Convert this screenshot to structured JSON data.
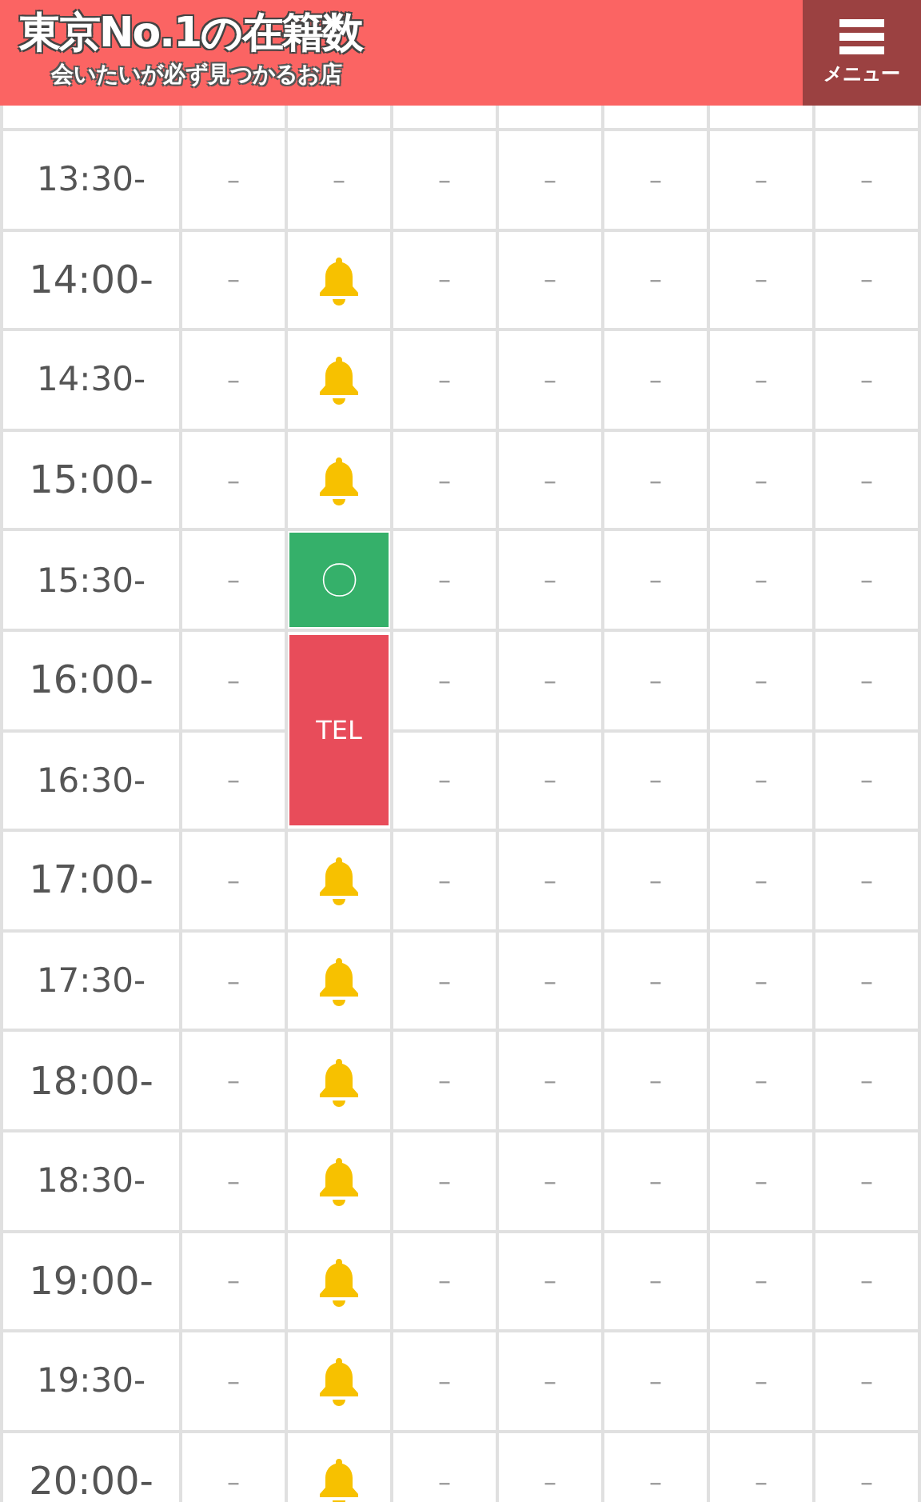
{
  "header": {
    "title": "東京No.1の在籍数",
    "subtitle": "会いたいが必ず見つかるお店",
    "menu_label": "メニュー"
  },
  "rows": [
    {
      "time": "13:30-",
      "kind": "half",
      "cells": [
        {
          "kind": "dash",
          "text": "–"
        },
        {
          "kind": "dash",
          "text": "–"
        },
        {
          "kind": "dash",
          "text": "–"
        },
        {
          "kind": "dash",
          "text": "–"
        },
        {
          "kind": "dash",
          "text": "–"
        },
        {
          "kind": "dash",
          "text": "–"
        },
        {
          "kind": "dash",
          "text": "–"
        }
      ]
    },
    {
      "time": "14:00-",
      "kind": "hour",
      "cells": [
        {
          "kind": "dash",
          "text": "–"
        },
        {
          "kind": "bell"
        },
        {
          "kind": "dash",
          "text": "–"
        },
        {
          "kind": "dash",
          "text": "–"
        },
        {
          "kind": "dash",
          "text": "–"
        },
        {
          "kind": "dash",
          "text": "–"
        },
        {
          "kind": "dash",
          "text": "–"
        }
      ]
    },
    {
      "time": "14:30-",
      "kind": "half",
      "cells": [
        {
          "kind": "dash",
          "text": "–"
        },
        {
          "kind": "bell"
        },
        {
          "kind": "dash",
          "text": "–"
        },
        {
          "kind": "dash",
          "text": "–"
        },
        {
          "kind": "dash",
          "text": "–"
        },
        {
          "kind": "dash",
          "text": "–"
        },
        {
          "kind": "dash",
          "text": "–"
        }
      ]
    },
    {
      "time": "15:00-",
      "kind": "hour",
      "cells": [
        {
          "kind": "dash",
          "text": "–"
        },
        {
          "kind": "bell"
        },
        {
          "kind": "dash",
          "text": "–"
        },
        {
          "kind": "dash",
          "text": "–"
        },
        {
          "kind": "dash",
          "text": "–"
        },
        {
          "kind": "dash",
          "text": "–"
        },
        {
          "kind": "dash",
          "text": "–"
        }
      ]
    },
    {
      "time": "15:30-",
      "kind": "half",
      "cells": [
        {
          "kind": "dash",
          "text": "–"
        },
        {
          "kind": "ok",
          "text": "〇"
        },
        {
          "kind": "dash",
          "text": "–"
        },
        {
          "kind": "dash",
          "text": "–"
        },
        {
          "kind": "dash",
          "text": "–"
        },
        {
          "kind": "dash",
          "text": "–"
        },
        {
          "kind": "dash",
          "text": "–"
        }
      ]
    },
    {
      "time": "16:00-",
      "kind": "hour",
      "cells": [
        {
          "kind": "dash",
          "text": "–"
        },
        {
          "kind": "tel",
          "text": "TEL"
        },
        {
          "kind": "dash",
          "text": "–"
        },
        {
          "kind": "dash",
          "text": "–"
        },
        {
          "kind": "dash",
          "text": "–"
        },
        {
          "kind": "dash",
          "text": "–"
        },
        {
          "kind": "dash",
          "text": "–"
        }
      ]
    },
    {
      "time": "16:30-",
      "kind": "half",
      "cells": [
        {
          "kind": "dash",
          "text": "–"
        },
        {
          "kind": "merged"
        },
        {
          "kind": "dash",
          "text": "–"
        },
        {
          "kind": "dash",
          "text": "–"
        },
        {
          "kind": "dash",
          "text": "–"
        },
        {
          "kind": "dash",
          "text": "–"
        },
        {
          "kind": "dash",
          "text": "–"
        }
      ]
    },
    {
      "time": "17:00-",
      "kind": "hour",
      "cells": [
        {
          "kind": "dash",
          "text": "–"
        },
        {
          "kind": "bell"
        },
        {
          "kind": "dash",
          "text": "–"
        },
        {
          "kind": "dash",
          "text": "–"
        },
        {
          "kind": "dash",
          "text": "–"
        },
        {
          "kind": "dash",
          "text": "–"
        },
        {
          "kind": "dash",
          "text": "–"
        }
      ]
    },
    {
      "time": "17:30-",
      "kind": "half",
      "cells": [
        {
          "kind": "dash",
          "text": "–"
        },
        {
          "kind": "bell"
        },
        {
          "kind": "dash",
          "text": "–"
        },
        {
          "kind": "dash",
          "text": "–"
        },
        {
          "kind": "dash",
          "text": "–"
        },
        {
          "kind": "dash",
          "text": "–"
        },
        {
          "kind": "dash",
          "text": "–"
        }
      ]
    },
    {
      "time": "18:00-",
      "kind": "hour",
      "cells": [
        {
          "kind": "dash",
          "text": "–"
        },
        {
          "kind": "bell"
        },
        {
          "kind": "dash",
          "text": "–"
        },
        {
          "kind": "dash",
          "text": "–"
        },
        {
          "kind": "dash",
          "text": "–"
        },
        {
          "kind": "dash",
          "text": "–"
        },
        {
          "kind": "dash",
          "text": "–"
        }
      ]
    },
    {
      "time": "18:30-",
      "kind": "half",
      "cells": [
        {
          "kind": "dash",
          "text": "–"
        },
        {
          "kind": "bell"
        },
        {
          "kind": "dash",
          "text": "–"
        },
        {
          "kind": "dash",
          "text": "–"
        },
        {
          "kind": "dash",
          "text": "–"
        },
        {
          "kind": "dash",
          "text": "–"
        },
        {
          "kind": "dash",
          "text": "–"
        }
      ]
    },
    {
      "time": "19:00-",
      "kind": "hour",
      "cells": [
        {
          "kind": "dash",
          "text": "–"
        },
        {
          "kind": "bell"
        },
        {
          "kind": "dash",
          "text": "–"
        },
        {
          "kind": "dash",
          "text": "–"
        },
        {
          "kind": "dash",
          "text": "–"
        },
        {
          "kind": "dash",
          "text": "–"
        },
        {
          "kind": "dash",
          "text": "–"
        }
      ]
    },
    {
      "time": "19:30-",
      "kind": "half",
      "cells": [
        {
          "kind": "dash",
          "text": "–"
        },
        {
          "kind": "bell"
        },
        {
          "kind": "dash",
          "text": "–"
        },
        {
          "kind": "dash",
          "text": "–"
        },
        {
          "kind": "dash",
          "text": "–"
        },
        {
          "kind": "dash",
          "text": "–"
        },
        {
          "kind": "dash",
          "text": "–"
        }
      ]
    },
    {
      "time": "20:00-",
      "kind": "hour",
      "cells": [
        {
          "kind": "dash",
          "text": "–"
        },
        {
          "kind": "bell"
        },
        {
          "kind": "dash",
          "text": "–"
        },
        {
          "kind": "dash",
          "text": "–"
        },
        {
          "kind": "dash",
          "text": "–"
        },
        {
          "kind": "dash",
          "text": "–"
        },
        {
          "kind": "dash",
          "text": "–"
        }
      ]
    }
  ]
}
